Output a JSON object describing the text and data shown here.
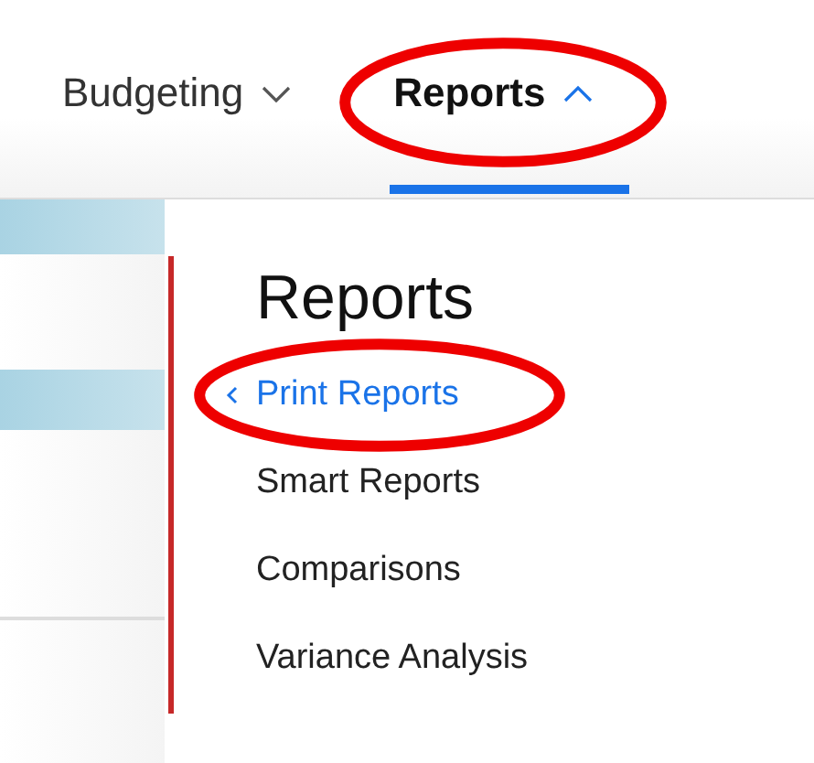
{
  "nav": [
    {
      "label": "Budgeting",
      "selected": false,
      "expanded": false,
      "circled": false
    },
    {
      "label": "Reports",
      "selected": true,
      "expanded": true,
      "circled": true
    }
  ],
  "menu": {
    "title": "Reports",
    "items": [
      {
        "label": "Print Reports",
        "selected": true,
        "circled": true
      },
      {
        "label": "Smart Reports",
        "selected": false,
        "circled": false
      },
      {
        "label": "Comparisons",
        "selected": false,
        "circled": false
      },
      {
        "label": "Variance Analysis",
        "selected": false,
        "circled": false
      }
    ]
  }
}
